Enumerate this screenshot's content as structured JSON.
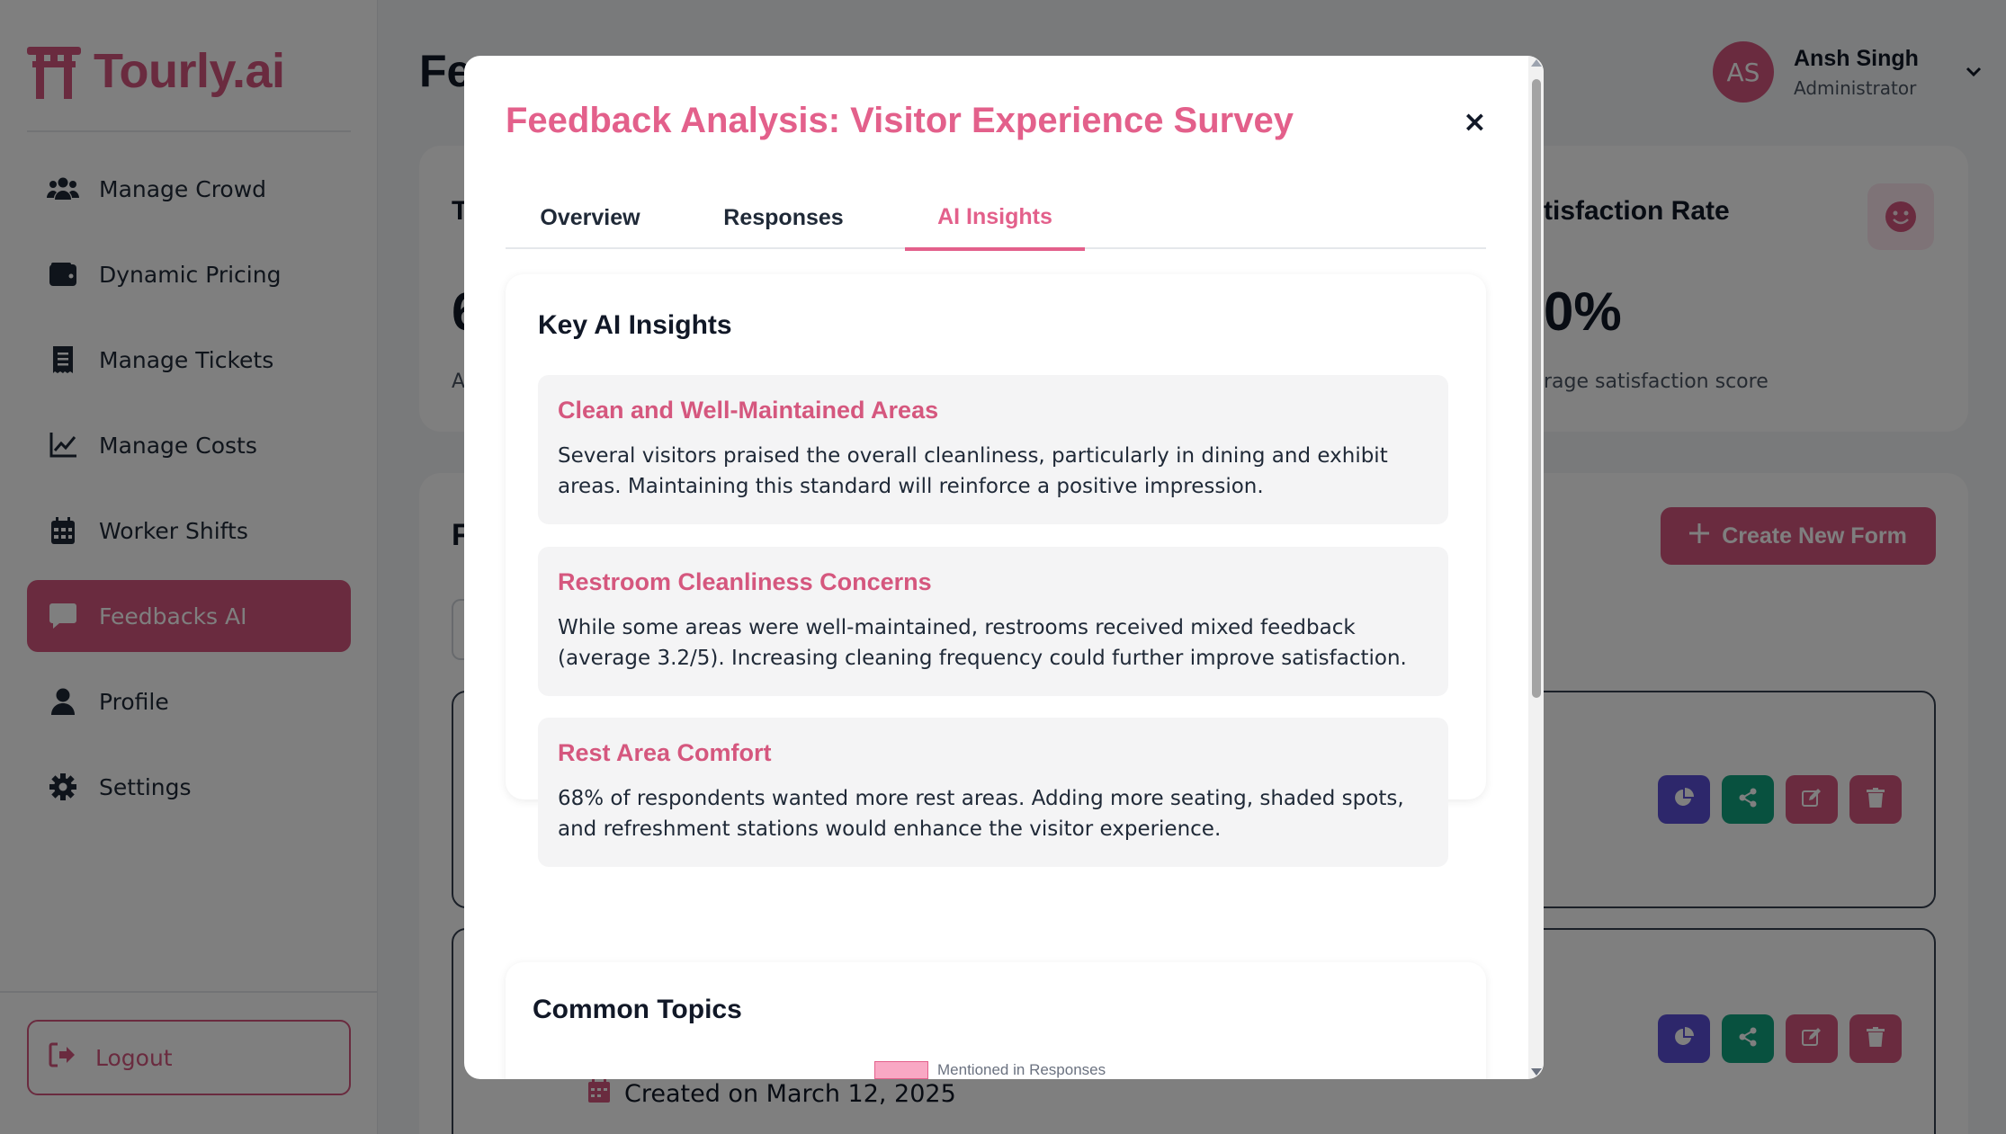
{
  "app": {
    "logo_text": "Tourly.ai"
  },
  "sidebar": {
    "items": [
      {
        "label": "Manage Crowd",
        "icon": "users-icon"
      },
      {
        "label": "Dynamic Pricing",
        "icon": "wallet-icon"
      },
      {
        "label": "Manage Tickets",
        "icon": "receipt-icon"
      },
      {
        "label": "Manage Costs",
        "icon": "chart-line-icon"
      },
      {
        "label": "Worker Shifts",
        "icon": "calendar-icon"
      },
      {
        "label": "Feedbacks AI",
        "icon": "comment-icon",
        "active": true
      },
      {
        "label": "Profile",
        "icon": "user-icon"
      },
      {
        "label": "Settings",
        "icon": "gear-icon"
      }
    ],
    "logout_label": "Logout"
  },
  "header": {
    "title": "Fe",
    "user": {
      "initials": "AS",
      "name": "Ansh Singh",
      "role": "Administrator"
    }
  },
  "stats": {
    "left_title": "T",
    "left_value": "6",
    "left_sub": "A",
    "right_title": "tisfaction Rate",
    "right_value": "0%",
    "right_sub": "rage satisfaction score"
  },
  "forms": {
    "title": "F",
    "create_label": "Create New Form",
    "created_text": "Created on March 12, 2025"
  },
  "modal": {
    "title": "Feedback Analysis: Visitor Experience Survey",
    "close": "×",
    "tabs": [
      "Overview",
      "Responses",
      "AI Insights"
    ],
    "active_tab": "AI Insights",
    "insights_heading": "Key AI Insights",
    "insights": [
      {
        "title": "Clean and Well-Maintained Areas",
        "body": "Several visitors praised the overall cleanliness, particularly in dining and exhibit areas. Maintaining this standard will reinforce a positive impression."
      },
      {
        "title": "Restroom Cleanliness Concerns",
        "body": "While some areas were well-maintained, restrooms received mixed feedback (average 3.2/5). Increasing cleaning frequency could further improve satisfaction."
      },
      {
        "title": "Rest Area Comfort",
        "body": "68% of respondents wanted more rest areas. Adding more seating, shaded spots, and refreshment stations would enhance the visitor experience."
      }
    ],
    "topics_heading": "Common Topics",
    "legend_label": "Mentioned in Responses"
  },
  "colors": {
    "brand": "#d5577e",
    "accent_title": "#e3608b",
    "purple": "#5b4fd6",
    "green": "#10a37f"
  }
}
